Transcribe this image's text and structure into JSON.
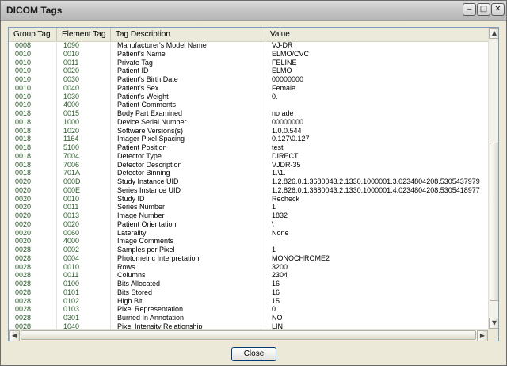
{
  "window": {
    "title": "DICOM Tags",
    "minimize_icon": "minimize-icon",
    "maximize_icon": "maximize-icon",
    "close_icon": "close-icon"
  },
  "table": {
    "columns": [
      "Group Tag",
      "Element Tag",
      "Tag Description",
      "Value"
    ],
    "rows": [
      [
        "0008",
        "1090",
        "Manufacturer's Model Name",
        "VJ-DR"
      ],
      [
        "0010",
        "0010",
        "Patient's Name",
        "ELMO/CVC"
      ],
      [
        "0010",
        "0011",
        "Private Tag",
        "FELINE"
      ],
      [
        "0010",
        "0020",
        "Patient ID",
        "ELMO"
      ],
      [
        "0010",
        "0030",
        "Patient's Birth Date",
        "00000000"
      ],
      [
        "0010",
        "0040",
        "Patient's Sex",
        "Female"
      ],
      [
        "0010",
        "1030",
        "Patient's Weight",
        "0."
      ],
      [
        "0010",
        "4000",
        "Patient Comments",
        ""
      ],
      [
        "0018",
        "0015",
        "Body Part Examined",
        "no ade"
      ],
      [
        "0018",
        "1000",
        "Device Serial Number",
        "00000000"
      ],
      [
        "0018",
        "1020",
        "Software Versions(s)",
        "1.0.0.544"
      ],
      [
        "0018",
        "1164",
        "Imager Pixel Spacing",
        "0.127\\0.127"
      ],
      [
        "0018",
        "5100",
        "Patient Position",
        "test"
      ],
      [
        "0018",
        "7004",
        "Detector Type",
        "DIRECT"
      ],
      [
        "0018",
        "7006",
        "Detector Description",
        "VJDR-35"
      ],
      [
        "0018",
        "701A",
        "Detector Binning",
        "1.\\1."
      ],
      [
        "0020",
        "000D",
        "Study Instance UID",
        "1.2.826.0.1.3680043.2.1330.1000001.3.0234804208.5305437979"
      ],
      [
        "0020",
        "000E",
        "Series Instance UID",
        "1.2.826.0.1.3680043.2.1330.1000001.4.0234804208.5305418977"
      ],
      [
        "0020",
        "0010",
        "Study ID",
        "Recheck"
      ],
      [
        "0020",
        "0011",
        "Series Number",
        "1"
      ],
      [
        "0020",
        "0013",
        "Image Number",
        "1832"
      ],
      [
        "0020",
        "0020",
        "Patient Orientation",
        "\\"
      ],
      [
        "0020",
        "0060",
        "Laterality",
        "None"
      ],
      [
        "0020",
        "4000",
        "Image Comments",
        ""
      ],
      [
        "0028",
        "0002",
        "Samples per Pixel",
        "1"
      ],
      [
        "0028",
        "0004",
        "Photometric Interpretation",
        "MONOCHROME2"
      ],
      [
        "0028",
        "0010",
        "Rows",
        "3200"
      ],
      [
        "0028",
        "0011",
        "Columns",
        "2304"
      ],
      [
        "0028",
        "0100",
        "Bits Allocated",
        "16"
      ],
      [
        "0028",
        "0101",
        "Bits Stored",
        "16"
      ],
      [
        "0028",
        "0102",
        "High Bit",
        "15"
      ],
      [
        "0028",
        "0103",
        "Pixel Representation",
        "0"
      ],
      [
        "0028",
        "0301",
        "Burned In Annotation",
        "NO"
      ],
      [
        "0028",
        "1040",
        "Pixel Intensity Relationship",
        "LIN"
      ]
    ]
  },
  "scrollbars": {
    "up_icon": "scroll-up-icon",
    "down_icon": "scroll-down-icon",
    "left_icon": "scroll-left-icon",
    "right_icon": "scroll-right-icon"
  },
  "footer": {
    "close_label": "Close"
  }
}
